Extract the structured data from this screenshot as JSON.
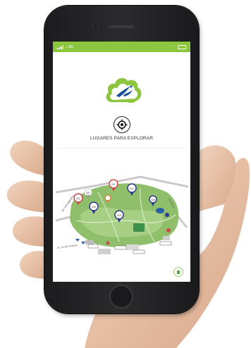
{
  "status_bar": {
    "carrier": "ᵢₗ 4G",
    "right_text": "⁻⁻"
  },
  "app": {
    "explore_label": "LUGARES PARA EXPLORAR",
    "logo_icon": "cloud-bird-logo",
    "target_icon": "crosshair-target-icon",
    "home_icon": "home-icon"
  },
  "map": {
    "markers": [
      {
        "label": "011",
        "color": "#c94b4b"
      },
      {
        "label": "001",
        "color": "#f0f0f0"
      },
      {
        "label": "012",
        "color": "#c94b4b"
      },
      {
        "label": "001",
        "color": "#2f3a8c"
      },
      {
        "label": "002",
        "color": "#2f3a8c"
      },
      {
        "label": "010",
        "color": "#e07b39"
      },
      {
        "label": "013",
        "color": "#c94b4b"
      },
      {
        "label": "008",
        "color": "#2f3a8c"
      },
      {
        "label": "003",
        "color": "#2f3a8c"
      }
    ],
    "streets": [
      "Av. Insurgentes",
      "Av. 1ro de Octubre",
      "Periférico"
    ]
  },
  "colors": {
    "brand_green": "#8cc63f",
    "logo_blue": "#1e4f99",
    "map_green": "#8fbf6b"
  }
}
